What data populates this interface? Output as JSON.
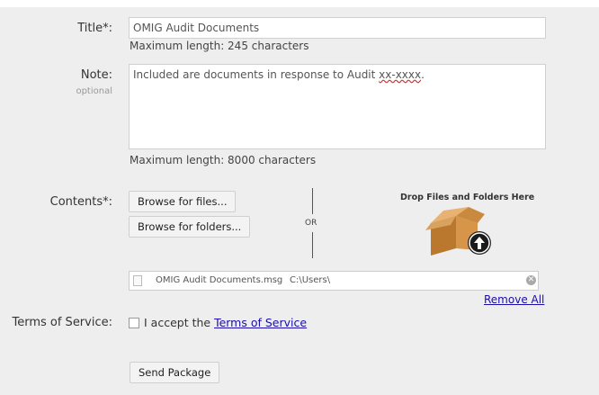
{
  "title_field": {
    "label": "Title*:",
    "value": "OMIG Audit Documents",
    "hint": "Maximum length: 245 characters"
  },
  "note_field": {
    "label": "Note:",
    "sublabel": "optional",
    "value_prefix": "Included are documents in response to Audit ",
    "value_marked": "xx-xxxx",
    "value_suffix": ".",
    "hint": "Maximum length: 8000 characters"
  },
  "contents": {
    "label": "Contents*:",
    "browse_files": "Browse for files...",
    "browse_folders": "Browse for folders...",
    "or": "OR",
    "drop_title": "Drop Files and Folders Here",
    "file": {
      "name": "OMIG Audit Documents.msg",
      "path": "C:\\Users\\"
    },
    "remove_all": "Remove All"
  },
  "terms": {
    "label": "Terms of Service:",
    "accept_prefix": "I accept the ",
    "link_text": "Terms of Service"
  },
  "send_button": "Send Package",
  "icons": {
    "drop": "box-upload-icon",
    "file": "file-icon",
    "remove": "remove-circle-icon"
  }
}
